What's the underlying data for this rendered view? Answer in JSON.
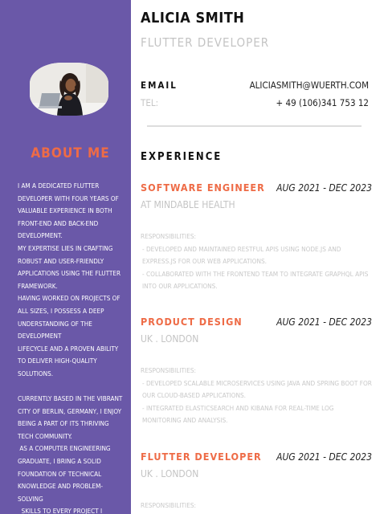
{
  "profile": {
    "name": "ALICIA SMITH",
    "role": "FLUTTER DEVELOPER",
    "email_label": "EMAIL",
    "email": "ALICIASMITH@WUERTH.COM",
    "tel_label": "TEL:",
    "tel": "+ 49 (106)341 753 12"
  },
  "sidebar": {
    "about_title": "ABOUT ME",
    "about_paragraphs": [
      "I AM A DEDICATED FLUTTER DEVELOPER WITH FOUR YEARS OF VALUABLE EXPERIENCE IN BOTH FRONT-END AND BACK-END DEVELOPMENT.",
      "MY EXPERTISE LIES IN CRAFTING ROBUST AND USER-FRIENDLY APPLICATIONS USING THE FLUTTER FRAMEWORK.",
      "HAVING WORKED ON PROJECTS OF ALL SIZES, I POSSESS A DEEP UNDERSTANDING OF THE DEVELOPMENT",
      "LIFECYCLE AND A PROVEN ABILITY TO DELIVER HIGH-QUALITY SOLUTIONS.",
      "CURRENTLY BASED IN THE VIBRANT CITY OF BERLIN, GERMANY, I ENJOY BEING A PART OF ITS THRIVING TECH COMMUNITY.",
      " AS A COMPUTER ENGINEERING GRADUATE, I BRING A SOLID FOUNDATION OF TECHNICAL KNOWLEDGE AND PROBLEM-SOLVING",
      "  SKILLS TO EVERY PROJECT I UNDERT..."
    ]
  },
  "experience": {
    "title": "EXPERIENCE",
    "jobs": [
      {
        "title": "SOFTWARE ENGINEER",
        "dates": "AUG 2021 - DEC 2023",
        "company": "AT MINDABLE HEALTH",
        "resp_label": "RESPONSIBILITIES:",
        "bullets": [
          "- DEVELOPED AND MAINTAINED RESTFUL APIS USING NODE.JS AND EXPRESS.JS FOR OUR WEB APPLICATIONS.",
          "- COLLABORATED WITH THE FRONTEND TEAM TO INTEGRATE GRAPHQL APIS INTO OUR APPLICATIONS."
        ]
      },
      {
        "title": "PRODUCT DESIGN",
        "dates": "AUG 2021 - DEC 2023",
        "company": "UK . LONDON",
        "resp_label": "RESPONSIBILITIES:",
        "bullets": [
          "- DEVELOPED SCALABLE MICROSERVICES USING JAVA AND SPRING BOOT FOR OUR CLOUD-BASED APPLICATIONS.",
          "- INTEGRATED ELASTICSEARCH AND KIBANA FOR REAL-TIME LOG MONITORING AND ANALYSIS."
        ]
      },
      {
        "title": "FLUTTER DEVELOPER",
        "dates": "AUG 2021 - DEC 2023",
        "company": "UK . LONDON",
        "resp_label": "RESPONSIBILITIES:",
        "bullets": []
      }
    ]
  },
  "colors": {
    "sidebar": "#6a58a8",
    "accent": "#ee6b46"
  }
}
